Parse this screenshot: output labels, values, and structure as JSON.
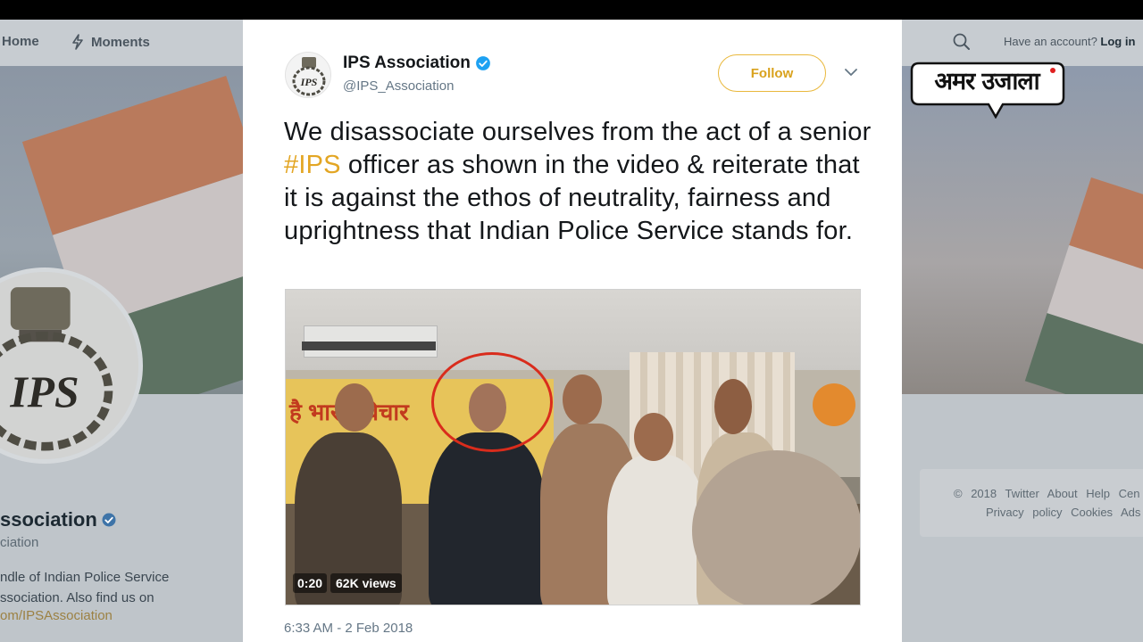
{
  "nav": {
    "home_label": "Home",
    "moments_label": "Moments",
    "account_prompt": "Have an account?",
    "login_label": "Log in"
  },
  "profile": {
    "name": "ssociation",
    "handle": "ciation",
    "bio_line1": "ndle of Indian Police Service",
    "bio_line2": "ssociation. Also find us on",
    "link": "om/IPSAssociation"
  },
  "footer": {
    "line1": "© 2018 Twitter  About  Help Cen",
    "line2": "Privacy policy  Cookies  Ads"
  },
  "tweet": {
    "author_name": "IPS Association",
    "author_handle": "@IPS_Association",
    "follow_label": "Follow",
    "text_before": "We disassociate ourselves from the act of a senior ",
    "hashtag": "#IPS",
    "text_after": " officer as shown in the video & reiterate that it is against the ethos of neutrality, fairness and uprightness that Indian Police Service stands for.",
    "timestamp": "6:33 AM - 2 Feb 2018"
  },
  "video": {
    "duration": "0:20",
    "views": "62K views",
    "banner_text": "है भारत      विचार"
  },
  "watermark": {
    "text": "अमर उजाला"
  },
  "colors": {
    "accent": "#e3a624",
    "follow_border": "#e9b83c",
    "verified": "#1da1f2",
    "circle": "#d92c1c"
  },
  "icons": [
    "lightning-bolt-icon",
    "search-icon",
    "verified-badge-icon",
    "chevron-down-icon",
    "ips-emblem-icon"
  ]
}
